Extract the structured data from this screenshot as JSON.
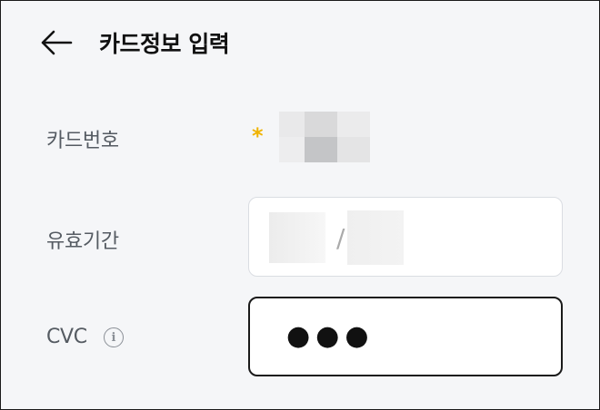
{
  "header": {
    "back_icon": "arrow-left-icon",
    "title": "카드정보 입력"
  },
  "card_number": {
    "label": "카드번호",
    "mask_glyph": "*",
    "mask_color": "#f0b300"
  },
  "expiry": {
    "label": "유효기간",
    "separator": "/"
  },
  "cvc": {
    "label": "CVC",
    "info_icon": "info-icon",
    "value_display": "●●●"
  },
  "colors": {
    "background": "#f5f6f8",
    "field_border": "#dadde2",
    "focused_border": "#1a1a1a",
    "label_text": "#555b62"
  }
}
